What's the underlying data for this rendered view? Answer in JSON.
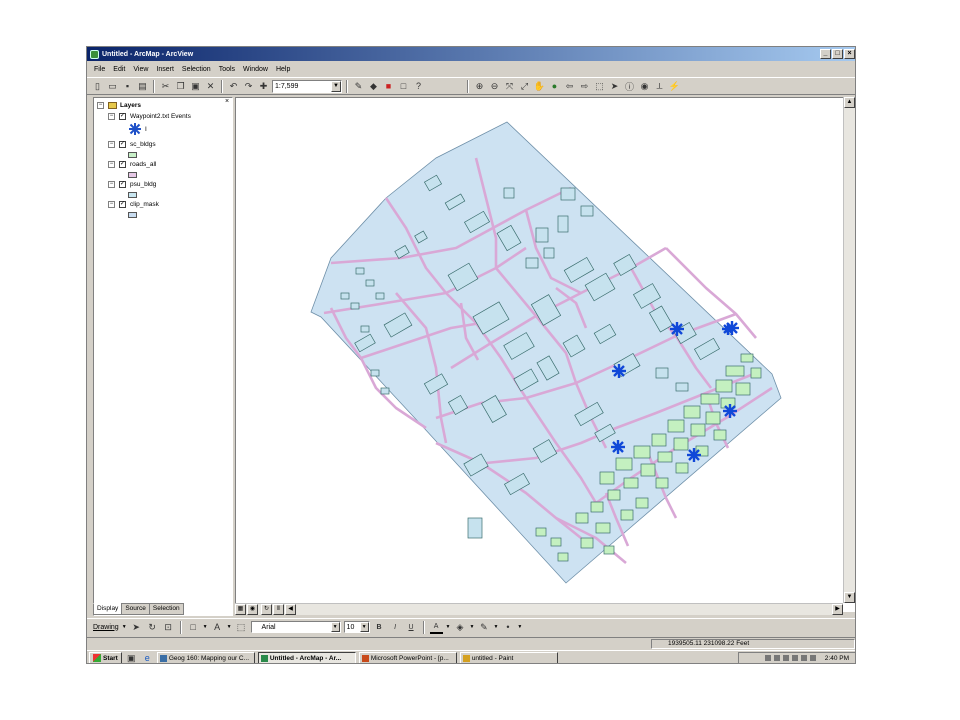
{
  "window": {
    "title": "Untitled - ArcMap - ArcView",
    "buttons": {
      "minimize": "_",
      "maximize": "□",
      "close": "×"
    }
  },
  "menu": [
    "File",
    "Edit",
    "View",
    "Insert",
    "Selection",
    "Tools",
    "Window",
    "Help"
  ],
  "toolbar": {
    "scale": "1:7,599",
    "icons": [
      "new-icon",
      "open-icon",
      "save-icon",
      "print-icon",
      "cut-icon",
      "copy-icon",
      "paste-icon",
      "delete-icon",
      "undo-icon",
      "redo-icon",
      "add-data-icon",
      "editor-icon",
      "arctoolbox-icon",
      "command-line-icon",
      "whats-this-icon",
      "zoom-in-icon",
      "zoom-out-icon",
      "fixed-zoom-in-icon",
      "fixed-zoom-out-icon",
      "pan-icon",
      "full-extent-icon",
      "back-icon",
      "forward-icon",
      "select-features-icon",
      "select-elements-icon",
      "identify-icon",
      "find-icon",
      "hyperlink-icon"
    ]
  },
  "toc": {
    "root": "Layers",
    "layers": [
      {
        "name": "Waypoint2.txt Events",
        "checked": true,
        "symbol": "asterisk",
        "symbol_color": "#1e50c8"
      },
      {
        "name": "sc_bldgs",
        "checked": true,
        "symbol": "fill",
        "symbol_color": "#c8f0c8"
      },
      {
        "name": "roads_all",
        "checked": true,
        "symbol": "fill",
        "symbol_color": "#e6c8e6"
      },
      {
        "name": "psu_bldg",
        "checked": true,
        "symbol": "fill",
        "symbol_color": "#c8e6f0"
      },
      {
        "name": "clip_mask",
        "checked": true,
        "symbol": "fill",
        "symbol_color": "#c8dcf0"
      }
    ],
    "tabs": [
      "Display",
      "Source",
      "Selection"
    ]
  },
  "map": {
    "colors": {
      "clip_mask": "#cde2f2",
      "roads": "#d9a8d6",
      "buildings_edge": "#3b6e6e",
      "sc_bldgs": "#c4f0c0",
      "points": "#1048d8"
    },
    "waypoint_count": 7
  },
  "drawing_toolbar": {
    "drawing_label": "Drawing",
    "font": "Arial",
    "font_size": "10",
    "bold": "B",
    "italic": "I",
    "underline": "U",
    "font_color_label": "A"
  },
  "status": {
    "coords": "1939505.11  231098.22 Feet"
  },
  "taskbar": {
    "start": "Start",
    "tasks": [
      {
        "label": "Geog 160: Mapping our C...",
        "active": false
      },
      {
        "label": "Untitled - ArcMap - Ar...",
        "active": true
      },
      {
        "label": "Microsoft PowerPoint - [p...",
        "active": false
      },
      {
        "label": "untitled - Paint",
        "active": false
      }
    ],
    "clock": "2:40 PM"
  }
}
